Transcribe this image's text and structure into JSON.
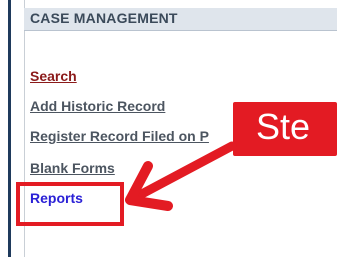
{
  "panel": {
    "title": "CASE MANAGEMENT"
  },
  "nav": {
    "items": [
      {
        "label": "Search"
      },
      {
        "label": "Add Historic Record"
      },
      {
        "label": "Register Record Filed on P"
      },
      {
        "label": "Blank Forms"
      },
      {
        "label": "Reports"
      }
    ]
  },
  "annotation": {
    "callout_text": "Ste",
    "color": "#e31b23"
  }
}
